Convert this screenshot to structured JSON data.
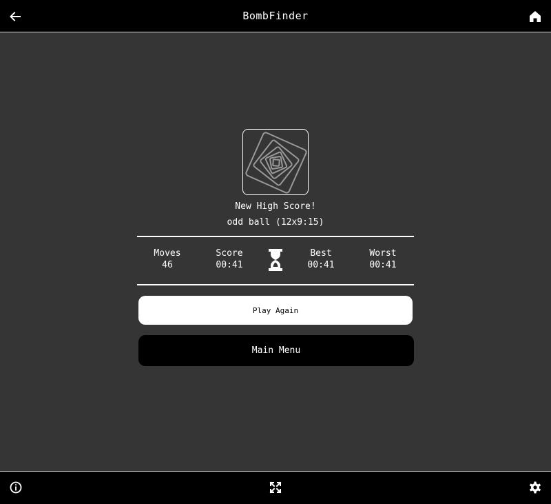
{
  "header": {
    "title": "BombFinder",
    "back_icon": "arrow-left-icon",
    "home_icon": "home-icon"
  },
  "result": {
    "badge_icon": "nested-squares-icon",
    "headline": "New High Score!",
    "game_mode": "odd ball (12x9:15)"
  },
  "stats": {
    "moves_label": "Moves",
    "moves_value": "46",
    "score_label": "Score",
    "score_value": "00:41",
    "timer_icon": "hourglass-icon",
    "best_label": "Best",
    "best_value": "00:41",
    "worst_label": "Worst",
    "worst_value": "00:41"
  },
  "actions": {
    "play_again_label": "Play Again",
    "main_menu_label": "Main Menu"
  },
  "footer": {
    "info_icon": "info-icon",
    "fullscreen_icon": "fullscreen-icon",
    "settings_icon": "gear-icon"
  },
  "colors": {
    "background": "#353535",
    "bar": "#000000",
    "foreground": "#ffffff"
  }
}
